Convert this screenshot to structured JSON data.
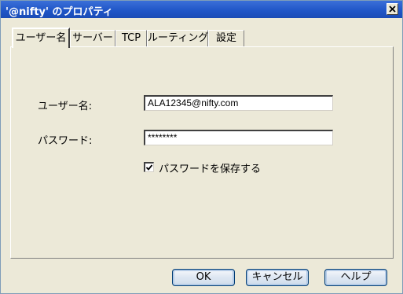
{
  "window": {
    "title": "'@nifty' のプロパティ",
    "close_icon": "close-icon"
  },
  "tabs": [
    {
      "label": "ユーザー名",
      "active": true
    },
    {
      "label": "サーバー"
    },
    {
      "label": "TCP"
    },
    {
      "label": "ルーティング"
    },
    {
      "label": "設定"
    }
  ],
  "form": {
    "username_label": "ユーザー名:",
    "username_value": "ALA12345@nifty.com",
    "password_label": "パスワード:",
    "password_value": "********",
    "save_password_label": "パスワードを保存する",
    "save_password_checked": true
  },
  "buttons": {
    "ok": "OK",
    "cancel": "キャンセル",
    "help": "ヘルプ"
  }
}
